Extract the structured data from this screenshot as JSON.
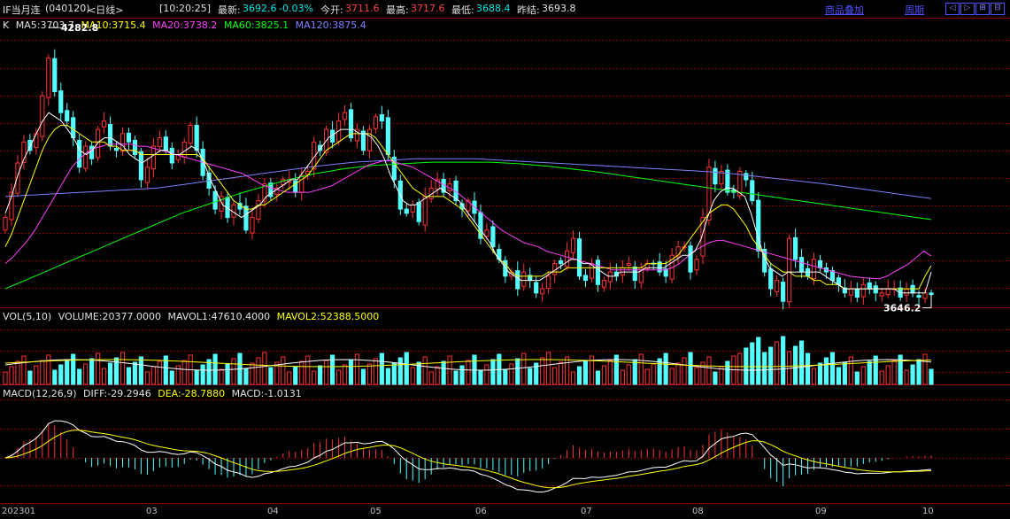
{
  "header": {
    "title": "IF当月连",
    "code": "(040120)",
    "period": "<日线>",
    "time": "[10:20:25]",
    "latest_label": "最新:",
    "latest_value": "3692.6",
    "change_value": "-0.03%",
    "open_label": "今开:",
    "open_value": "3711.6",
    "high_label": "最高:",
    "high_value": "3717.6",
    "low_label": "最低:",
    "low_value": "3688.4",
    "prev_label": "昨结:",
    "prev_value": "3693.8",
    "overlay_link": "商品叠加",
    "period_link": "周期"
  },
  "main_legend": {
    "k": "K",
    "ma5": "MA5:3703.7",
    "ma10": "MA10:3715.4",
    "ma20": "MA20:3738.2",
    "ma60": "MA60:3825.1",
    "ma120": "MA120:3875.4"
  },
  "annotations": {
    "high": "4282.8",
    "low": "3646.2"
  },
  "vol_legend": {
    "name": "VOL(5,10)",
    "volume": "VOLUME:20377.0000",
    "mavol1": "MAVOL1:47610.4000",
    "mavol2": "MAVOL2:52388.5000"
  },
  "macd_legend": {
    "name": "MACD(12,26,9)",
    "diff": "DIFF:-29.2946",
    "dea": "DEA:-28.7880",
    "macd": "MACD:-1.0131"
  },
  "x_axis": [
    "202301",
    "03",
    "04",
    "05",
    "06",
    "07",
    "08",
    "09",
    "10"
  ],
  "colors": {
    "up": "#ff3232",
    "down": "#54ffff",
    "ma5": "#ffffff",
    "ma10": "#ffff00",
    "ma20": "#ff40ff",
    "ma60": "#00ff00",
    "ma120": "#8080ff",
    "grid": "#800000"
  },
  "chart_data": {
    "type": "candlestick",
    "price_range": [
      3620,
      4300
    ],
    "closes": [
      3830,
      3890,
      3960,
      4010,
      3990,
      4030,
      4120,
      4210,
      4130,
      4080,
      4060,
      4020,
      3950,
      4000,
      3970,
      4040,
      4060,
      4000,
      3990,
      4030,
      4010,
      3980,
      3920,
      3950,
      4000,
      4020,
      3990,
      3960,
      3980,
      4010,
      4050,
      3990,
      3930,
      3900,
      3850,
      3880,
      3830,
      3860,
      3850,
      3800,
      3830,
      3870,
      3910,
      3880,
      3900,
      3920,
      3920,
      3890,
      3930,
      3940,
      4010,
      3990,
      4040,
      4010,
      4060,
      4080,
      4020,
      4040,
      3990,
      4040,
      4070,
      4060,
      3980,
      3920,
      3850,
      3840,
      3860,
      3820,
      3880,
      3900,
      3920,
      3890,
      3910,
      3870,
      3850,
      3870,
      3840,
      3780,
      3800,
      3760,
      3730,
      3690,
      3700,
      3660,
      3700,
      3680,
      3650,
      3660,
      3690,
      3720,
      3720,
      3750,
      3780,
      3690,
      3680,
      3720,
      3670,
      3680,
      3700,
      3690,
      3710,
      3720,
      3680,
      3710,
      3720,
      3720,
      3700,
      3690,
      3740,
      3760,
      3760,
      3700,
      3730,
      3830,
      3950,
      3910,
      3940,
      3890,
      3890,
      3940,
      3920,
      3870,
      3750,
      3700,
      3660,
      3680,
      3630,
      3780,
      3730,
      3700,
      3690,
      3730,
      3710,
      3700,
      3680,
      3670,
      3650,
      3660,
      3640,
      3670,
      3660,
      3650,
      3650,
      3660,
      3660,
      3640,
      3660,
      3650,
      3640,
      3650,
      3646
    ],
    "ma5": [
      3840,
      3880,
      3930,
      3970,
      4000,
      4030,
      4060,
      4080,
      4070,
      4060,
      4040,
      4020,
      3990,
      3980,
      3990,
      4010,
      4020,
      4020,
      4010,
      4000,
      3980,
      3970,
      3960,
      3970,
      3980,
      3990,
      3990,
      3980,
      3980,
      3990,
      4000,
      3990,
      3960,
      3920,
      3890,
      3860,
      3850,
      3840,
      3830,
      3840,
      3850,
      3860,
      3880,
      3890,
      3900,
      3910,
      3920,
      3920,
      3940,
      3960,
      3980,
      4000,
      4020,
      4030,
      4040,
      4040,
      4040,
      4030,
      4030,
      4020,
      4000,
      3970,
      3930,
      3900,
      3870,
      3860,
      3860,
      3870,
      3880,
      3890,
      3900,
      3890,
      3880,
      3870,
      3850,
      3830,
      3810,
      3790,
      3770,
      3740,
      3720,
      3700,
      3690,
      3680,
      3680,
      3680,
      3680,
      3690,
      3700,
      3710,
      3720,
      3730,
      3730,
      3720,
      3720,
      3710,
      3700,
      3690,
      3690,
      3700,
      3700,
      3700,
      3700,
      3710,
      3710,
      3710,
      3710,
      3720,
      3730,
      3740,
      3740,
      3750,
      3780,
      3830,
      3870,
      3890,
      3900,
      3900,
      3890,
      3880,
      3840,
      3790,
      3740,
      3710,
      3700,
      3690,
      3700,
      3700,
      3700,
      3700,
      3700,
      3700,
      3690,
      3680,
      3670,
      3660,
      3660,
      3660,
      3660,
      3660,
      3660,
      3660,
      3660,
      3660,
      3650,
      3650,
      3650,
      3650,
      3650,
      3700
    ],
    "ma10": [
      3760,
      3790,
      3830,
      3870,
      3910,
      3950,
      3990,
      4020,
      4040,
      4050,
      4050,
      4040,
      4030,
      4020,
      4010,
      4010,
      4010,
      4000,
      4000,
      3990,
      3990,
      3990,
      3980,
      3980,
      3980,
      3980,
      3980,
      3980,
      3980,
      3980,
      3980,
      3980,
      3970,
      3950,
      3930,
      3910,
      3890,
      3870,
      3860,
      3850,
      3850,
      3860,
      3860,
      3870,
      3880,
      3890,
      3900,
      3910,
      3920,
      3930,
      3950,
      3970,
      3990,
      4000,
      4010,
      4020,
      4030,
      4030,
      4030,
      4030,
      4020,
      4000,
      3980,
      3960,
      3940,
      3920,
      3900,
      3890,
      3880,
      3880,
      3880,
      3880,
      3870,
      3860,
      3850,
      3830,
      3810,
      3790,
      3770,
      3750,
      3730,
      3720,
      3700,
      3690,
      3690,
      3690,
      3690,
      3690,
      3700,
      3700,
      3700,
      3710,
      3710,
      3710,
      3710,
      3710,
      3710,
      3710,
      3710,
      3710,
      3710,
      3710,
      3710,
      3710,
      3720,
      3720,
      3720,
      3720,
      3730,
      3740,
      3760,
      3780,
      3800,
      3820,
      3840,
      3850,
      3860,
      3860,
      3850,
      3830,
      3810,
      3780,
      3760,
      3740,
      3720,
      3710,
      3700,
      3700,
      3690,
      3690,
      3690,
      3680,
      3680,
      3670,
      3670,
      3670,
      3660,
      3660,
      3660,
      3660,
      3660,
      3660,
      3660,
      3660,
      3660,
      3660,
      3660,
      3660,
      3660,
      3690,
      3715
    ],
    "ma20": [
      3720,
      3735,
      3755,
      3775,
      3800,
      3830,
      3860,
      3890,
      3920,
      3950,
      3970,
      3985,
      3995,
      4000,
      4005,
      4005,
      4005,
      4005,
      4000,
      4000,
      3995,
      3990,
      3985,
      3980,
      3975,
      3970,
      3965,
      3960,
      3955,
      3950,
      3945,
      3940,
      3935,
      3925,
      3915,
      3905,
      3900,
      3895,
      3890,
      3890,
      3890,
      3890,
      3895,
      3900,
      3905,
      3915,
      3925,
      3935,
      3945,
      3955,
      3960,
      3965,
      3965,
      3960,
      3955,
      3950,
      3940,
      3930,
      3920,
      3910,
      3900,
      3890,
      3875,
      3860,
      3845,
      3830,
      3815,
      3800,
      3790,
      3780,
      3770,
      3765,
      3760,
      3750,
      3745,
      3740,
      3735,
      3730,
      3725,
      3720,
      3715,
      3710,
      3705,
      3705,
      3705,
      3705,
      3705,
      3705,
      3705,
      3705,
      3710,
      3720,
      3735,
      3750,
      3760,
      3770,
      3775,
      3775,
      3770,
      3765,
      3760,
      3755,
      3750,
      3745,
      3740,
      3735,
      3730,
      3725,
      3720,
      3715,
      3710,
      3705,
      3700,
      3695,
      3690,
      3688,
      3686,
      3685,
      3684,
      3690,
      3700,
      3710,
      3720,
      3735,
      3750,
      3738
    ],
    "ma60": [
      3660,
      3675,
      3690,
      3705,
      3720,
      3735,
      3750,
      3765,
      3780,
      3795,
      3810,
      3825,
      3840,
      3852,
      3864,
      3876,
      3888,
      3898,
      3908,
      3918,
      3926,
      3934,
      3940,
      3946,
      3950,
      3954,
      3956,
      3958,
      3960,
      3962,
      3962,
      3962,
      3962,
      3962,
      3960,
      3958,
      3955,
      3952,
      3948,
      3944,
      3940,
      3935,
      3930,
      3925,
      3920,
      3915,
      3910,
      3905,
      3900,
      3895,
      3890,
      3885,
      3880,
      3875,
      3870,
      3865,
      3860,
      3855,
      3850,
      3845,
      3840,
      3835,
      3830,
      3825.1
    ],
    "ma120": [
      3880,
      3882,
      3884,
      3886,
      3888,
      3890,
      3892,
      3894,
      3896,
      3898,
      3900,
      3905,
      3910,
      3915,
      3920,
      3925,
      3930,
      3935,
      3940,
      3945,
      3950,
      3954,
      3958,
      3962,
      3964,
      3966,
      3968,
      3970,
      3970,
      3970,
      3970,
      3970,
      3968,
      3966,
      3964,
      3962,
      3960,
      3958,
      3956,
      3954,
      3952,
      3950,
      3948,
      3946,
      3944,
      3942,
      3940,
      3937,
      3934,
      3930,
      3926,
      3922,
      3918,
      3914,
      3910,
      3905,
      3900,
      3895,
      3890,
      3885,
      3880,
      3875.4
    ]
  }
}
